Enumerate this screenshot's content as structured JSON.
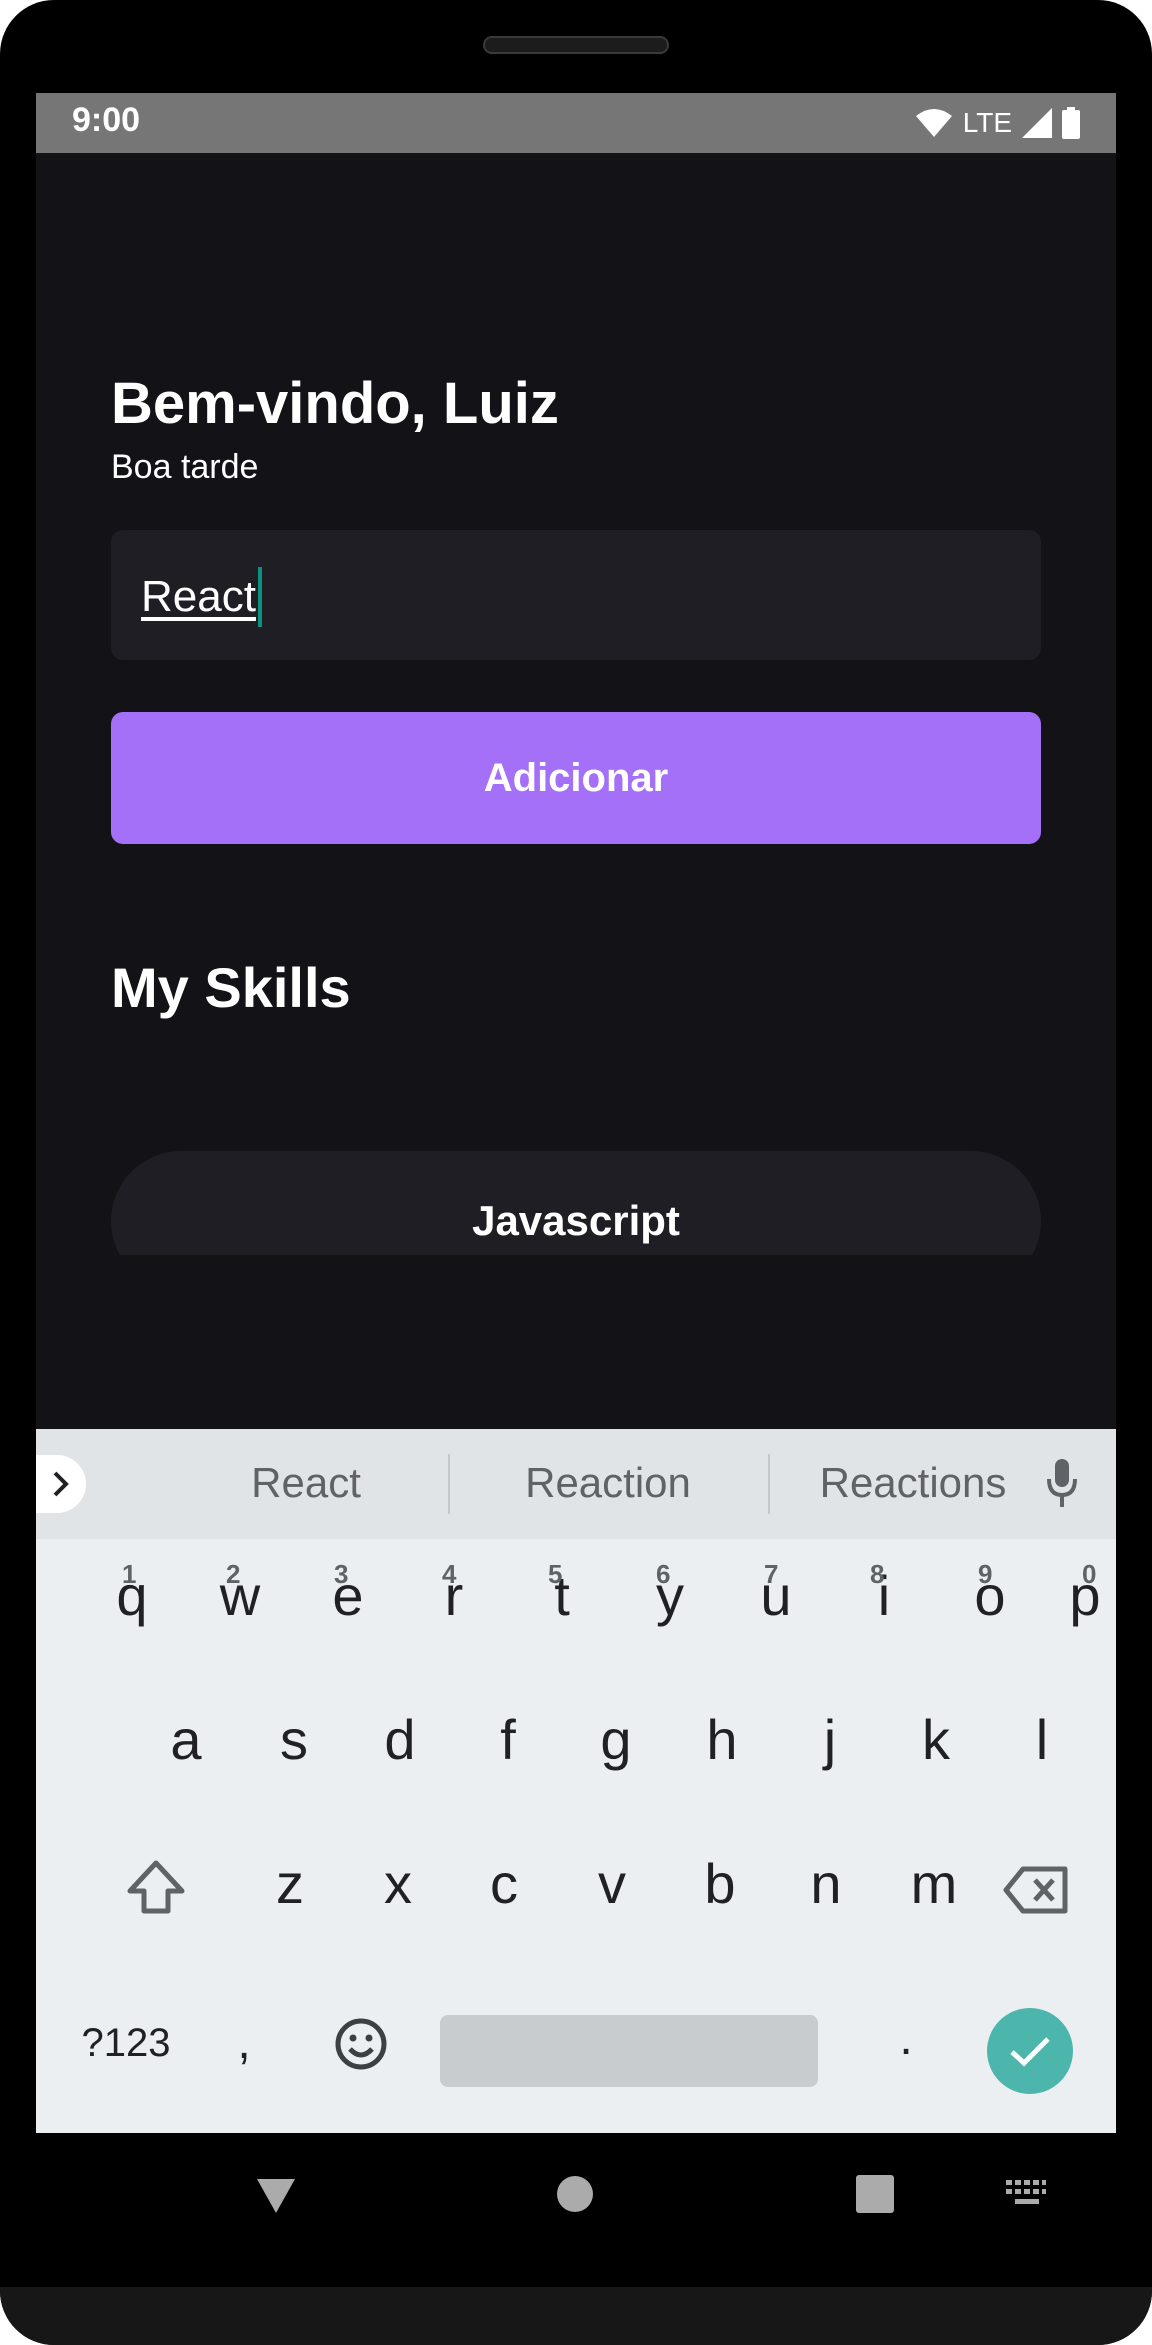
{
  "status": {
    "time": "9:00",
    "network": "LTE"
  },
  "app": {
    "greeting": "Bem-vindo, Luiz",
    "subgreeting": "Boa tarde",
    "input_value": "React",
    "add_button": "Adicionar",
    "section_title": "My Skills",
    "skills": [
      "Javascript"
    ]
  },
  "keyboard": {
    "suggestions": [
      "React",
      "Reaction",
      "Reactions"
    ],
    "row1": [
      "q",
      "w",
      "e",
      "r",
      "t",
      "y",
      "u",
      "i",
      "o",
      "p"
    ],
    "row1_hints": [
      "1",
      "2",
      "3",
      "4",
      "5",
      "6",
      "7",
      "8",
      "9",
      "0"
    ],
    "row2": [
      "a",
      "s",
      "d",
      "f",
      "g",
      "h",
      "j",
      "k",
      "l"
    ],
    "row3": [
      "z",
      "x",
      "c",
      "v",
      "b",
      "n",
      "m"
    ],
    "symbols_key": "?123",
    "comma_key": ",",
    "period_key": "."
  },
  "colors": {
    "background": "#131217",
    "accent": "#a370f7",
    "input_bg": "#1f1e25",
    "enter_key": "#4db6ac"
  }
}
